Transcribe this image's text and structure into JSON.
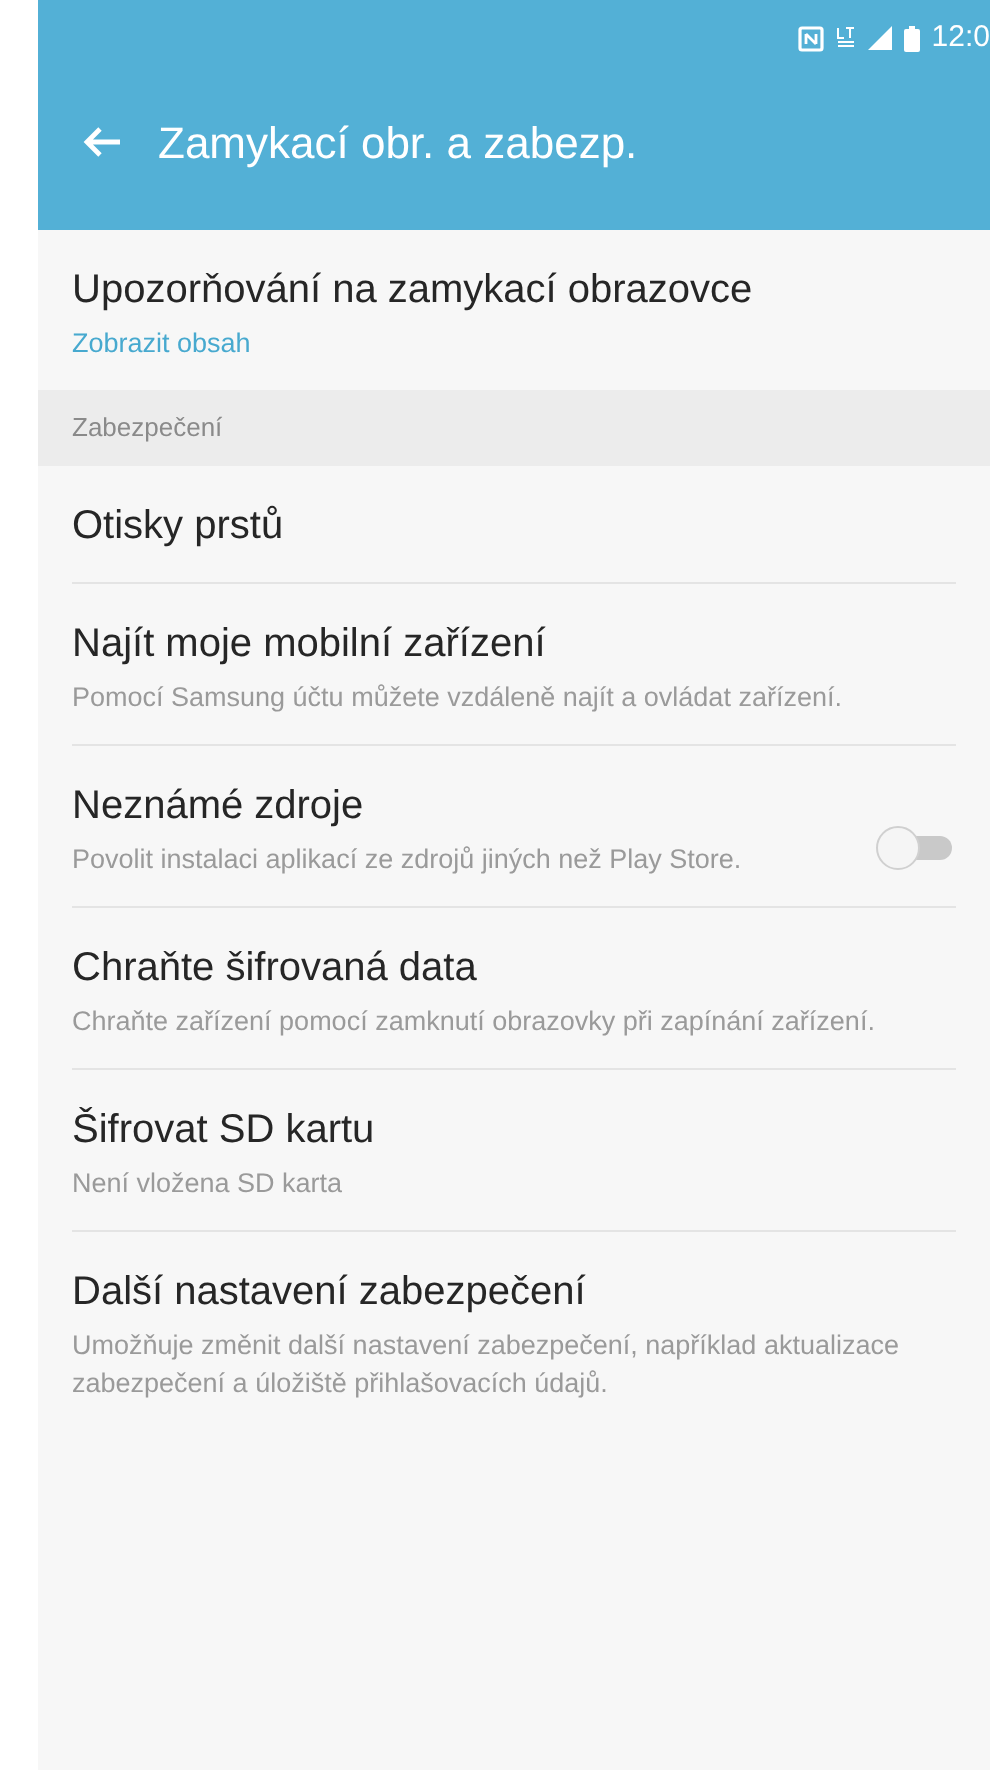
{
  "status_bar": {
    "time": "12:0"
  },
  "app_bar": {
    "title": "Zamykací obr. a zabezp."
  },
  "rows": [
    {
      "kind": "item",
      "title": "Upozorňování na zamykací obrazovce",
      "summary": "Zobrazit obsah",
      "summary_highlighted": true
    },
    {
      "kind": "section",
      "title": "Zabezpečení"
    },
    {
      "kind": "item",
      "title": "Otisky prstů"
    },
    {
      "kind": "item",
      "title": "Najít moje mobilní zařízení",
      "summary": "Pomocí Samsung účtu můžete vzdáleně najít a ovládat zařízení.",
      "summary_highlighted": false
    },
    {
      "kind": "toggle",
      "title": "Neznámé zdroje",
      "summary": "Povolit instalaci aplikací ze zdrojů jiných než Play Store.",
      "summary_highlighted": false,
      "on": false
    },
    {
      "kind": "item",
      "title": "Chraňte šifrovaná data",
      "summary": "Chraňte zařízení pomocí zamknutí obrazovky při zapínání zařízení.",
      "summary_highlighted": false
    },
    {
      "kind": "item",
      "title": "Šifrovat SD kartu",
      "summary": "Není vložena SD karta",
      "summary_highlighted": false
    },
    {
      "kind": "item",
      "title": "Další nastavení zabezpečení",
      "summary": "Umožňuje změnit další nastavení zabezpečení, například aktualizace zabezpečení a úložiště přihlašovacích údajů.",
      "summary_highlighted": false
    }
  ]
}
